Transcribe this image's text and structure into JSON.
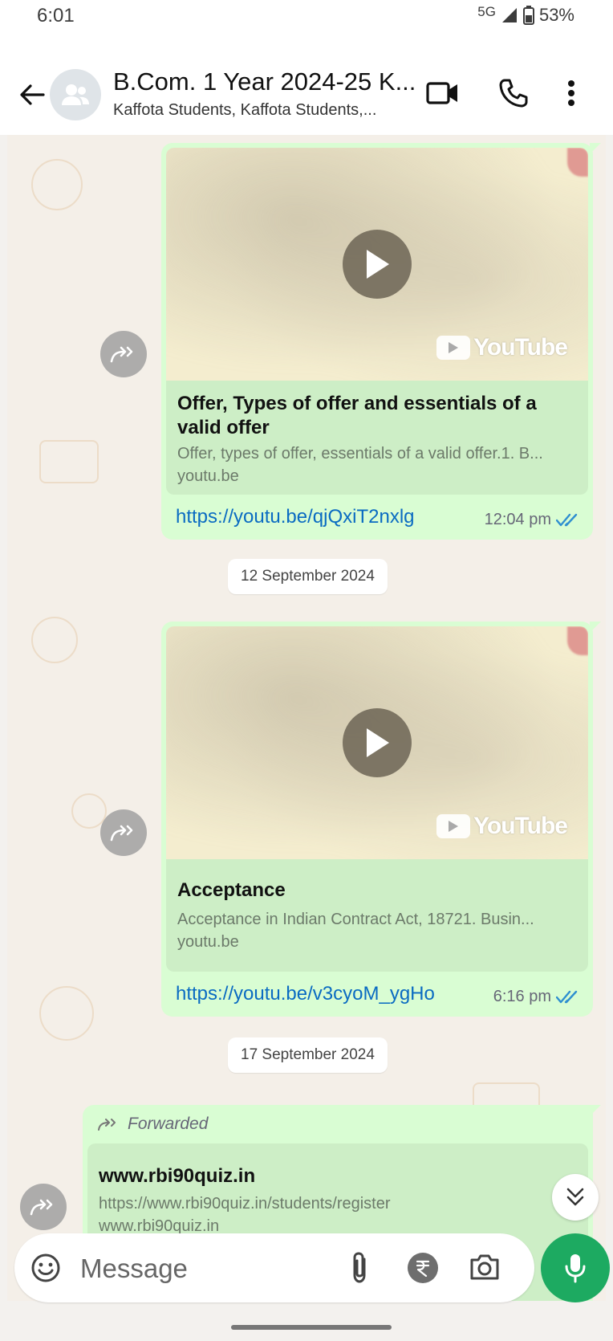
{
  "status_bar": {
    "time": "6:01",
    "network": "5G",
    "battery": "53%"
  },
  "header": {
    "title": "B.Com. 1 Year 2024-25 K...",
    "subtitle": "Kaffota Students, Kaffota Students,..."
  },
  "messages": [
    {
      "video_brand": "YouTube",
      "preview_title": "Offer, Types of offer and essentials of a valid offer",
      "preview_desc": "Offer, types of offer, essentials of a valid offer.1. B...",
      "preview_domain": "youtu.be",
      "url": "https://youtu.be/qjQxiT2nxlg",
      "time": "12:04 pm"
    },
    {
      "video_brand": "YouTube",
      "preview_title": "Acceptance",
      "preview_desc": "Acceptance in Indian Contract Act, 18721. Busin...",
      "preview_domain": "youtu.be",
      "url": "https://youtu.be/v3cyoM_ygHo",
      "time": "6:16 pm"
    },
    {
      "forwarded_label": "Forwarded",
      "preview_title": "www.rbi90quiz.in",
      "preview_desc": "https://www.rbi90quiz.in/students/register",
      "preview_domain": "www.rbi90quiz.in"
    }
  ],
  "date_separators": [
    "12 September 2024",
    "17 September 2024"
  ],
  "composer": {
    "placeholder": "Message"
  },
  "colors": {
    "bubble": "#d9fdd3",
    "link": "#0a6bc2",
    "mic": "#1daa61",
    "tick": "#53bdeb"
  }
}
